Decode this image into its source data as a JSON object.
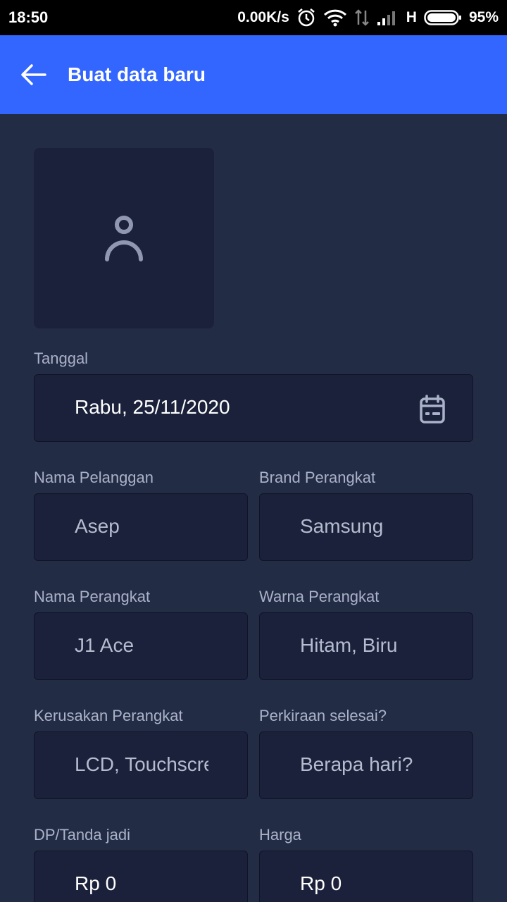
{
  "status_bar": {
    "time": "18:50",
    "net_speed": "0.00K/s",
    "network_type": "H",
    "battery": "95%",
    "icons": [
      "alarm-icon",
      "wifi-icon",
      "data-transfer-icon",
      "signal-icon",
      "battery-icon"
    ]
  },
  "app_bar": {
    "title": "Buat data baru",
    "back_icon": "arrow-left-icon",
    "color": "#3366ff"
  },
  "photo": {
    "icon": "person-icon"
  },
  "form": {
    "tanggal": {
      "label": "Tanggal",
      "value": "Rabu, 25/11/2020",
      "icon": "calendar-icon"
    },
    "nama_pelanggan": {
      "label": "Nama Pelanggan",
      "value": "Asep"
    },
    "brand_perangkat": {
      "label": "Brand Perangkat",
      "value": "Samsung"
    },
    "nama_perangkat": {
      "label": "Nama Perangkat",
      "value": "J1 Ace"
    },
    "warna_perangkat": {
      "label": "Warna Perangkat",
      "value": "Hitam, Biru"
    },
    "kerusakan_perangkat": {
      "label": "Kerusakan Perangkat",
      "value": "LCD, Touchscreen"
    },
    "perkiraan_selesai": {
      "label": "Perkiraan selesai?",
      "placeholder": "Berapa hari?"
    },
    "dp": {
      "label": "DP/Tanda jadi",
      "value": "Rp 0"
    },
    "harga": {
      "label": "Harga",
      "value": "Rp 0"
    }
  },
  "colors": {
    "background": "#232c45",
    "field_background": "#1b213a",
    "label": "#a9b2c8",
    "accent": "#3366ff"
  }
}
